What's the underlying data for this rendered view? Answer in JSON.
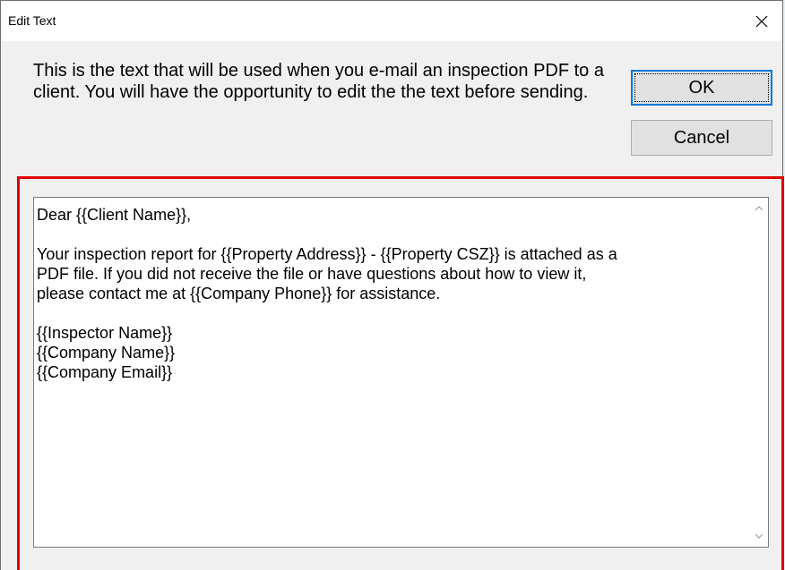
{
  "window": {
    "title": "Edit Text"
  },
  "description": "This is the text that will be used when you e-mail an inspection PDF to a client. You will have the opportunity to edit the the text before sending.",
  "buttons": {
    "ok_label": "OK",
    "cancel_label": "Cancel"
  },
  "editor": {
    "lines": [
      "Dear {{Client Name}},",
      "",
      "Your inspection report for {{Property Address}} - {{Property CSZ}} is attached as a",
      "PDF file. If you did not receive the file or have questions about how to view it,",
      "please contact me at {{Company Phone}} for assistance.",
      "",
      "{{Inspector Name}}",
      "{{Company Name}}",
      "{{Company Email}}"
    ]
  },
  "icons": {
    "close": "close-icon",
    "scroll_up": "chevron-up-icon",
    "scroll_down": "chevron-down-icon"
  },
  "colors": {
    "highlight": "#e00000",
    "focus_border": "#0078d7",
    "dialog_bg": "#f0f0f0"
  }
}
